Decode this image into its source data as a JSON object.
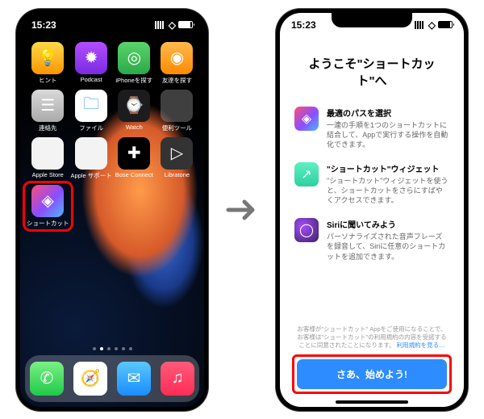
{
  "status": {
    "time": "15:23"
  },
  "home": {
    "apps_row1": [
      {
        "name": "tips",
        "label": "ヒント",
        "icon": "💡"
      },
      {
        "name": "podcast",
        "label": "Podcast",
        "icon": "✹"
      },
      {
        "name": "find-iphone",
        "label": "iPhoneを探す",
        "icon": "◎"
      },
      {
        "name": "find-friends",
        "label": "友達を探す",
        "icon": "◉"
      }
    ],
    "apps_row2": [
      {
        "name": "contacts",
        "label": "連絡先",
        "icon": "☰"
      },
      {
        "name": "files",
        "label": "ファイル",
        "icon": "🗀"
      },
      {
        "name": "watch",
        "label": "Watch",
        "icon": "⌚"
      },
      {
        "name": "utilities",
        "label": "便利ツール",
        "icon": ""
      }
    ],
    "apps_row3": [
      {
        "name": "app-store",
        "label": "Apple Store",
        "icon": ""
      },
      {
        "name": "apple-support",
        "label": "Apple サポート",
        "icon": ""
      },
      {
        "name": "bose-connect",
        "label": "Bose Connect",
        "icon": "✚"
      },
      {
        "name": "libratone",
        "label": "Libratone",
        "icon": "▷"
      }
    ],
    "shortcuts_app": {
      "name": "shortcuts",
      "label": "ショートカット",
      "icon": "◈"
    },
    "dock": [
      {
        "name": "phone",
        "icon": "✆"
      },
      {
        "name": "safari",
        "icon": "🧭"
      },
      {
        "name": "mail",
        "icon": "✉"
      },
      {
        "name": "music",
        "icon": "♫"
      }
    ]
  },
  "welcome": {
    "title": "ようこそ\"ショートカット\"へ",
    "features": [
      {
        "title": "最適のパスを選択",
        "desc": "一連の手順を1つのショートカットに結合して、Appで実行する操作を自動化できます。"
      },
      {
        "title": "\"ショートカット\"ウィジェット",
        "desc": "\"ショートカット\"ウィジェットを使うと、ショートカットをさらにすばやくアクセスできます。"
      },
      {
        "title": "Siriに聞いてみよう",
        "desc": "パーソナライズされた音声フレーズを録音して、Siriに任意のショートカットを追加できます。"
      }
    ],
    "legal_prefix": "お客様が\"ショートカット\" Appをご使用になることで、お客様は\"ショートカット\"の利用規約の内容を受諾することに同意されたことになります。",
    "legal_link": "利用規約を見る…",
    "start_button": "さあ、始めよう!"
  }
}
